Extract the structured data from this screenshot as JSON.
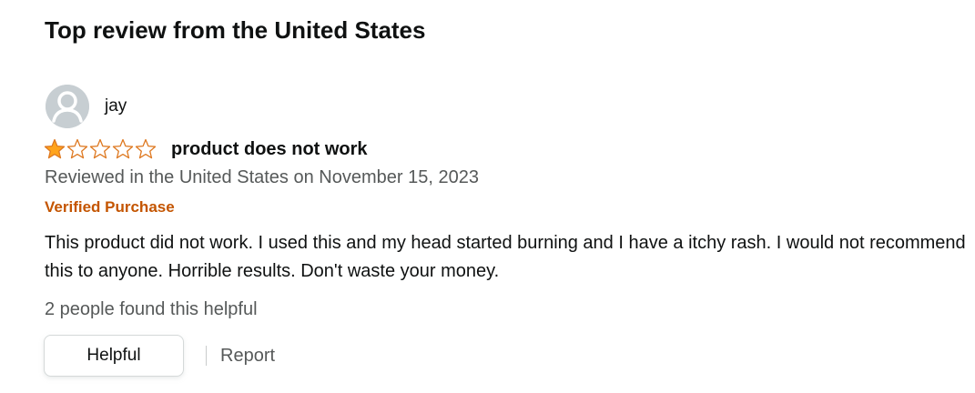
{
  "section": {
    "title": "Top review from the United States"
  },
  "review": {
    "author": "jay",
    "rating": 1,
    "rating_max": 5,
    "title": "product does not work",
    "date_line": "Reviewed in the United States on November 15, 2023",
    "badge": "Verified Purchase",
    "body": "This product did not work. I used this and my head started burning and I have a itchy rash. I would not recommend this to anyone. Horrible results. Don't waste your money.",
    "helpful_count_text": "2 people found this helpful"
  },
  "actions": {
    "helpful_label": "Helpful",
    "report_label": "Report"
  },
  "colors": {
    "star_fill": "#ffa41c",
    "star_outline": "#de7921",
    "badge": "#c45500",
    "muted_text": "#565959"
  },
  "icons": {
    "avatar": "default-user-avatar-icon",
    "star": "star-icon"
  }
}
